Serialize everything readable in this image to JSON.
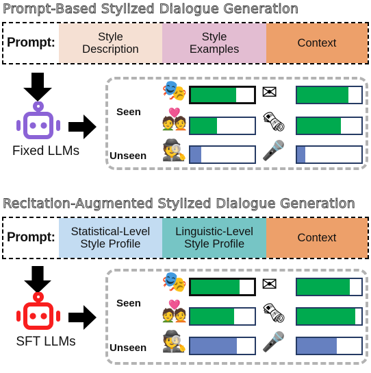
{
  "figure": {
    "sections": [
      {
        "id": "prompt-based",
        "title": "Prompt-Based Stylized Dialogue Generation",
        "prompt": {
          "label": "Prompt:",
          "segments": [
            {
              "text": "Style\nDescription",
              "color": "#f5e0d3",
              "width_pct": 33.6
            },
            {
              "text": "Style\nExamples",
              "color": "#e3bdd2",
              "width_pct": 33.6
            },
            {
              "text": "Context",
              "color": "#eda06a",
              "width_pct": 32.8
            }
          ]
        },
        "model": {
          "caption": "Fixed LLMs",
          "color": "#8b63d6",
          "icon": "robot-icon"
        },
        "groups": [
          {
            "label": "Seen"
          },
          {
            "label": "Unseen"
          }
        ],
        "rows": [
          {
            "persona": "shakespeare-persona-icon",
            "topic": "email-topic-icon",
            "group": "Seen",
            "left_value": 72,
            "right_value": 80,
            "left_color": "#00aa4f",
            "right_color": "#00aa4f"
          },
          {
            "persona": "romance-persona-icon",
            "topic": "news-topic-icon",
            "group": "Seen",
            "left_value": 42,
            "right_value": 68,
            "left_color": "#00aa4f",
            "right_color": "#00aa4f"
          },
          {
            "persona": "detective-persona-icon",
            "topic": "singer-topic-icon",
            "group": "Unseen",
            "left_value": 17,
            "right_value": 13,
            "left_color": "#6680c0",
            "right_color": "#6680c0"
          }
        ]
      },
      {
        "id": "recitation-augmented",
        "title": "Recitation-Augmented Stylized Dialogue Generation",
        "prompt": {
          "label": "Prompt:",
          "segments": [
            {
              "text": "Statistical-Level\nStyle Profile",
              "color": "#c3dcf2",
              "width_pct": 33.6
            },
            {
              "text": "Linguistic-Level\nStyle Profile",
              "color": "#76c5c5",
              "width_pct": 33.6
            },
            {
              "text": "Context",
              "color": "#eda06a",
              "width_pct": 32.8
            }
          ]
        },
        "model": {
          "caption": "SFT LLMs",
          "color": "#f81e1e",
          "icon": "robot-icon"
        },
        "groups": [
          {
            "label": "Seen"
          },
          {
            "label": "Unseen"
          }
        ],
        "rows": [
          {
            "persona": "shakespeare-persona-icon",
            "topic": "email-topic-icon",
            "group": "Seen",
            "left_value": 77,
            "right_value": 82,
            "left_color": "#00aa4f",
            "right_color": "#00aa4f"
          },
          {
            "persona": "romance-persona-icon",
            "topic": "news-topic-icon",
            "group": "Seen",
            "left_value": 68,
            "right_value": 90,
            "left_color": "#00aa4f",
            "right_color": "#00aa4f"
          },
          {
            "persona": "detective-persona-icon",
            "topic": "singer-topic-icon",
            "group": "Unseen",
            "left_value": 72,
            "right_value": 62,
            "left_color": "#6680c0",
            "right_color": "#6680c0"
          }
        ]
      }
    ],
    "icons": {
      "shakespeare-persona-icon": "🎭",
      "romance-persona-icon": "💑",
      "detective-persona-icon": "🕵",
      "email-topic-icon": "✉",
      "news-topic-icon": "🗞",
      "singer-topic-icon": "🎤"
    }
  },
  "chart_data": {
    "type": "bar",
    "title": "Stylized dialogue generation quality per persona and topic",
    "xlabel": "",
    "ylabel": "",
    "xlim": [
      0,
      100
    ],
    "grid": false,
    "legend": "none",
    "categories": [
      "Shakespeare / Email",
      "Romance / News",
      "Detective / Singer"
    ],
    "panels": [
      {
        "panel": "Prompt-Based Stylized Dialogue Generation",
        "model": "Fixed LLMs",
        "series": [
          {
            "name": "Left bar (Style Description prompt)",
            "values": [
              72,
              42,
              17
            ]
          },
          {
            "name": "Right bar (Style Examples prompt)",
            "values": [
              80,
              68,
              13
            ]
          }
        ],
        "seen_unseen": [
          "Seen",
          "Seen",
          "Unseen"
        ]
      },
      {
        "panel": "Recitation-Augmented Stylized Dialogue Generation",
        "model": "SFT LLMs",
        "series": [
          {
            "name": "Left bar (Statistical-Level Style Profile)",
            "values": [
              77,
              68,
              72
            ]
          },
          {
            "name": "Right bar (Linguistic-Level Style Profile)",
            "values": [
              82,
              90,
              62
            ]
          }
        ],
        "seen_unseen": [
          "Seen",
          "Seen",
          "Unseen"
        ]
      }
    ],
    "colors": {
      "seen": "#00aa4f",
      "unseen": "#6680c0",
      "track": "#ffffff",
      "track_border": "#253a63"
    }
  }
}
